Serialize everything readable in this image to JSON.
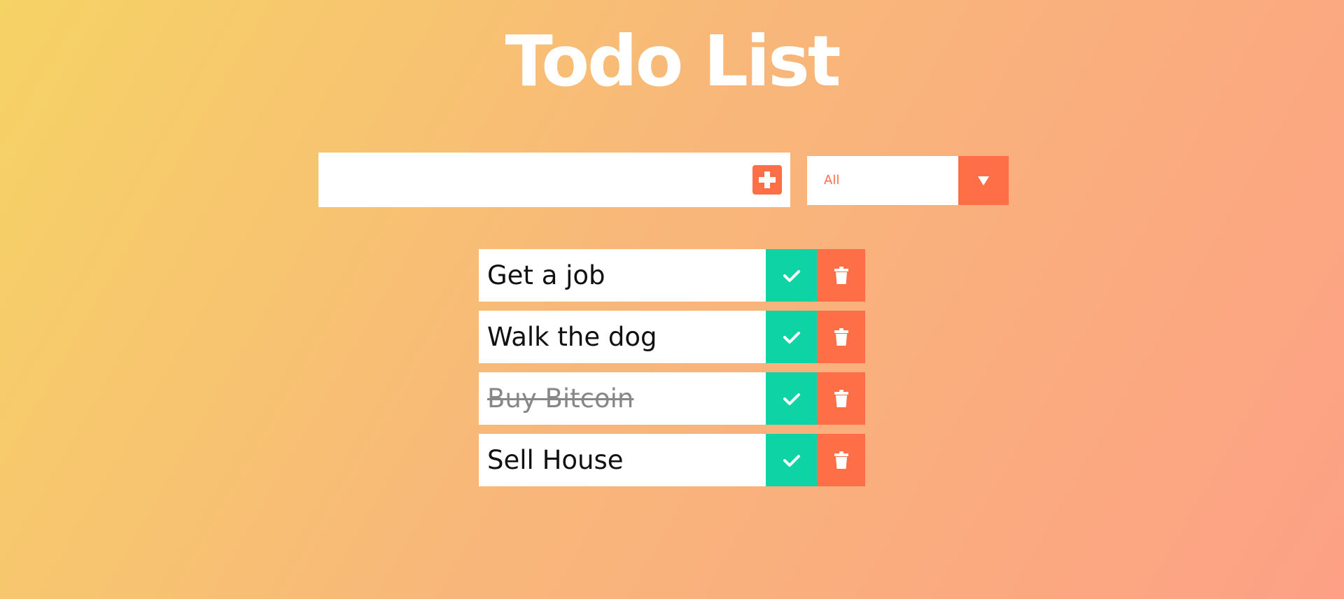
{
  "app": {
    "title": "Todo List"
  },
  "form": {
    "input_value": "",
    "input_placeholder": "",
    "add_icon": "plus-square-icon",
    "filter": {
      "selected": "All",
      "arrow_icon": "caret-down-icon"
    }
  },
  "todos": [
    {
      "text": "Get a job",
      "completed": false
    },
    {
      "text": "Walk the dog",
      "completed": false
    },
    {
      "text": "Buy Bitcoin",
      "completed": true
    },
    {
      "text": "Sell House",
      "completed": false
    }
  ],
  "colors": {
    "gradient_start": "#f6d365",
    "gradient_end": "#fda085",
    "accent": "#ff6f47",
    "complete": "#0ed3a5",
    "white": "#ffffff"
  }
}
